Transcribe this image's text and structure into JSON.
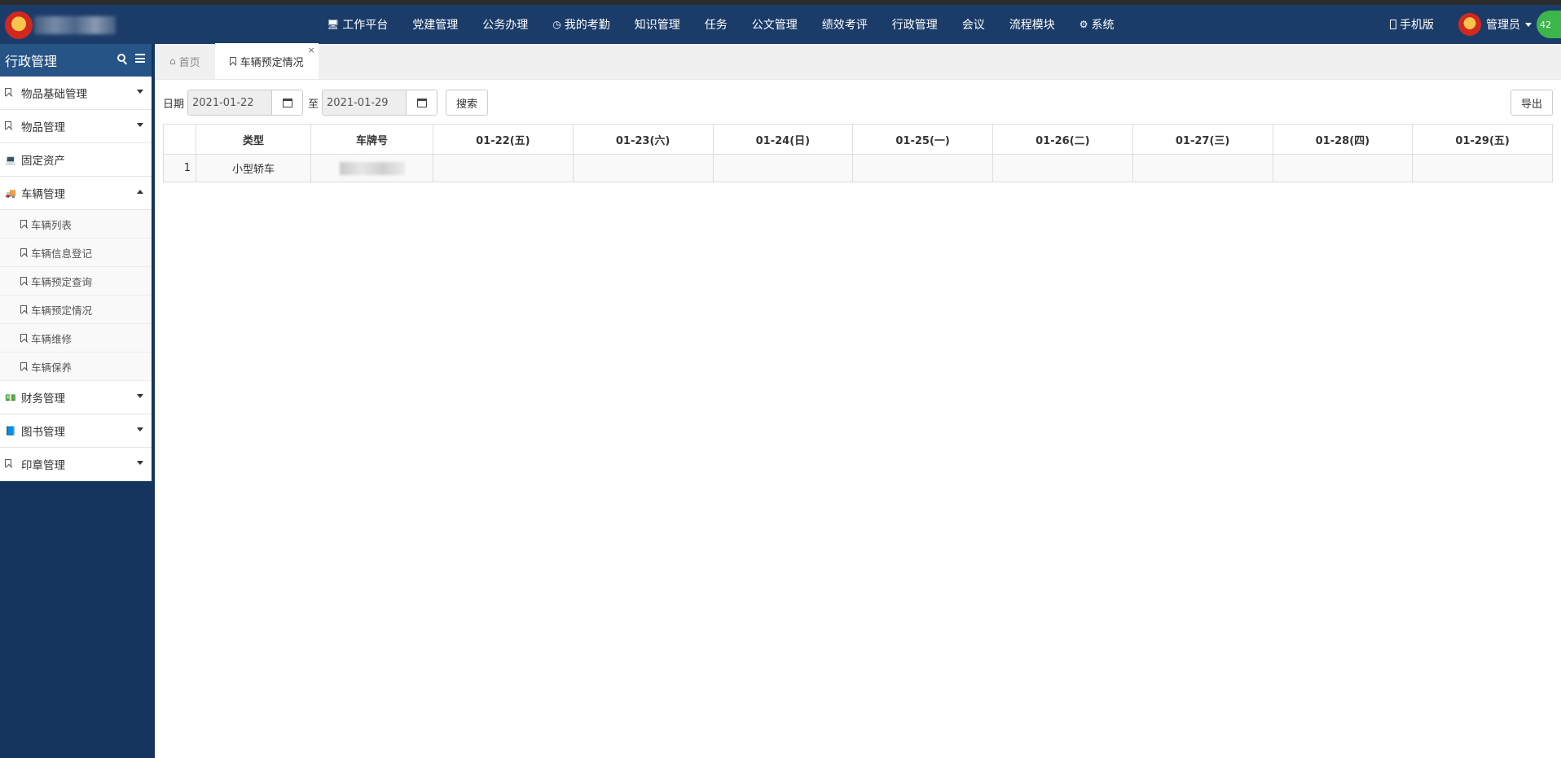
{
  "nav": {
    "items": [
      {
        "label": "工作平台",
        "icon": "monitor-icon"
      },
      {
        "label": "党建管理",
        "icon": ""
      },
      {
        "label": "公务办理",
        "icon": ""
      },
      {
        "label": "我的考勤",
        "icon": "clock-icon"
      },
      {
        "label": "知识管理",
        "icon": ""
      },
      {
        "label": "任务",
        "icon": ""
      },
      {
        "label": "公文管理",
        "icon": ""
      },
      {
        "label": "绩效考评",
        "icon": ""
      },
      {
        "label": "行政管理",
        "icon": ""
      },
      {
        "label": "会议",
        "icon": ""
      },
      {
        "label": "流程模块",
        "icon": ""
      },
      {
        "label": "系统",
        "icon": "gear-icon"
      }
    ],
    "mobile_label": "手机版",
    "user_label": "管理员",
    "badge": "42"
  },
  "sidebar": {
    "title": "行政管理",
    "items": [
      {
        "label": "物品基础管理"
      },
      {
        "label": "物品管理"
      },
      {
        "label": "固定资产"
      },
      {
        "label": "车辆管理"
      },
      {
        "label": "财务管理"
      },
      {
        "label": "图书管理"
      },
      {
        "label": "印章管理"
      }
    ],
    "sub_items": [
      {
        "label": "车辆列表"
      },
      {
        "label": "车辆信息登记"
      },
      {
        "label": "车辆预定查询"
      },
      {
        "label": "车辆预定情况"
      },
      {
        "label": "车辆维修"
      },
      {
        "label": "车辆保养"
      }
    ]
  },
  "tabs": {
    "home": "首页",
    "active": "车辆预定情况",
    "close": "×"
  },
  "toolbar": {
    "date_label": "日期",
    "start_date": "2021-01-22",
    "to_label": "至",
    "end_date": "2021-01-29",
    "search_label": "搜索",
    "export_label": "导出"
  },
  "table": {
    "columns": [
      "",
      "类型",
      "车牌号",
      "01-22(五)",
      "01-23(六)",
      "01-24(日)",
      "01-25(一)",
      "01-26(二)",
      "01-27(三)",
      "01-28(四)",
      "01-29(五)"
    ],
    "rows": [
      {
        "index": "1",
        "type": "小型轿车"
      }
    ]
  }
}
